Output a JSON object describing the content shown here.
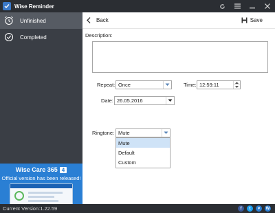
{
  "window": {
    "title": "Wise Reminder",
    "controls": [
      "refresh-icon",
      "menu-icon",
      "minimize-icon",
      "close-icon"
    ]
  },
  "sidebar": {
    "items": [
      {
        "label": "Unfinished",
        "icon": "alarm-clock-icon",
        "active": true
      },
      {
        "label": "Completed",
        "icon": "check-circle-icon",
        "active": false
      }
    ],
    "promo": {
      "title": "Wise Care 365",
      "badge": "4",
      "subtitle": "Official version has been released!"
    }
  },
  "toolbar": {
    "back_label": "Back",
    "save_label": "Save"
  },
  "form": {
    "description_label": "Description:",
    "description_value": "",
    "repeat_label": "Repeat:",
    "repeat_value": "Once",
    "time_label": "Time:",
    "time_value": "12:59:11",
    "date_label": "Date:",
    "date_value": "26.05.2016",
    "ringtone_label": "Ringtone:",
    "ringtone_value": "Mute",
    "ringtone_options": [
      "Mute",
      "Default",
      "Custom"
    ],
    "ringtone_highlighted": "Mute"
  },
  "status": {
    "version_text": "Current Version:1.22.59",
    "social": [
      {
        "icon": "facebook-icon",
        "glyph": "f",
        "color": "#3b5998"
      },
      {
        "icon": "twitter-icon",
        "glyph": "t",
        "color": "#1da1f2"
      },
      {
        "icon": "thumbs-up-icon",
        "glyph": "♥",
        "color": "#2a7fd4"
      },
      {
        "icon": "w-icon",
        "glyph": "W",
        "color": "#2a7fd4"
      }
    ]
  },
  "colors": {
    "titlebar": "#2b2e33",
    "sidebar": "#3a3e45",
    "sidebar_active": "#565b63",
    "promo": "#2a7fd4",
    "dropdown_highlight": "#cfe3f7"
  }
}
